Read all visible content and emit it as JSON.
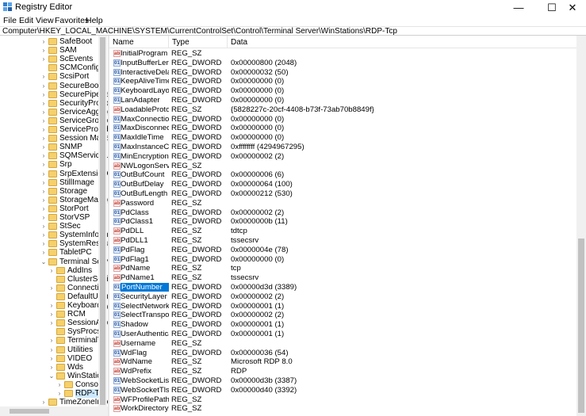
{
  "window": {
    "title": "Registry Editor",
    "controls": {
      "minimize": "—",
      "maximize": "☐",
      "close": "✕"
    }
  },
  "menu": [
    "File",
    "Edit",
    "View",
    "Favorites",
    "Help"
  ],
  "address": "Computer\\HKEY_LOCAL_MACHINE\\SYSTEM\\CurrentControlSet\\Control\\Terminal Server\\WinStations\\RDP-Tcp",
  "tree": {
    "items": [
      {
        "label": "SafeBoot",
        "depth": 0,
        "chevron": "›"
      },
      {
        "label": "SAM",
        "depth": 0,
        "chevron": "›"
      },
      {
        "label": "ScEvents",
        "depth": 0,
        "chevron": "›"
      },
      {
        "label": "SCMConfig",
        "depth": 0,
        "chevron": ""
      },
      {
        "label": "ScsiPort",
        "depth": 0,
        "chevron": "›"
      },
      {
        "label": "SecureBoot",
        "depth": 0,
        "chevron": "›"
      },
      {
        "label": "SecurePipeSer",
        "depth": 0,
        "chevron": "›"
      },
      {
        "label": "SecurityProvid",
        "depth": 0,
        "chevron": "›"
      },
      {
        "label": "ServiceAggreg",
        "depth": 0,
        "chevron": "›"
      },
      {
        "label": "ServiceGroupC",
        "depth": 0,
        "chevron": "›"
      },
      {
        "label": "ServiceProvide",
        "depth": 0,
        "chevron": "›"
      },
      {
        "label": "Session Manag",
        "depth": 0,
        "chevron": "›"
      },
      {
        "label": "SNMP",
        "depth": 0,
        "chevron": "›"
      },
      {
        "label": "SQMServiceLis",
        "depth": 0,
        "chevron": "›"
      },
      {
        "label": "Srp",
        "depth": 0,
        "chevron": "›"
      },
      {
        "label": "SrpExtensionC",
        "depth": 0,
        "chevron": "›"
      },
      {
        "label": "StillImage",
        "depth": 0,
        "chevron": "›"
      },
      {
        "label": "Storage",
        "depth": 0,
        "chevron": "›"
      },
      {
        "label": "StorageManag",
        "depth": 0,
        "chevron": "›"
      },
      {
        "label": "StorPort",
        "depth": 0,
        "chevron": "›"
      },
      {
        "label": "StorVSP",
        "depth": 0,
        "chevron": "›"
      },
      {
        "label": "StSec",
        "depth": 0,
        "chevron": "›"
      },
      {
        "label": "SystemInform",
        "depth": 0,
        "chevron": "›"
      },
      {
        "label": "SystemResour",
        "depth": 0,
        "chevron": "›"
      },
      {
        "label": "TabletPC",
        "depth": 0,
        "chevron": "›"
      },
      {
        "label": "Terminal Serve",
        "depth": 0,
        "chevron": "⌄"
      },
      {
        "label": "AddIns",
        "depth": 1,
        "chevron": "›"
      },
      {
        "label": "ClusterSetti",
        "depth": 1,
        "chevron": ""
      },
      {
        "label": "Connection",
        "depth": 1,
        "chevron": "›"
      },
      {
        "label": "DefaultUser",
        "depth": 1,
        "chevron": ""
      },
      {
        "label": "KeyboardTy",
        "depth": 1,
        "chevron": "›"
      },
      {
        "label": "RCM",
        "depth": 1,
        "chevron": "›"
      },
      {
        "label": "SessionArb",
        "depth": 1,
        "chevron": "›"
      },
      {
        "label": "SysProcs",
        "depth": 1,
        "chevron": ""
      },
      {
        "label": "TerminalTy",
        "depth": 1,
        "chevron": "›"
      },
      {
        "label": "Utilities",
        "depth": 1,
        "chevron": "›"
      },
      {
        "label": "VIDEO",
        "depth": 1,
        "chevron": "›"
      },
      {
        "label": "Wds",
        "depth": 1,
        "chevron": "›"
      },
      {
        "label": "WinStation",
        "depth": 1,
        "chevron": "⌄"
      },
      {
        "label": "Console",
        "depth": 2,
        "chevron": "›"
      },
      {
        "label": "RDP-Tcp",
        "depth": 2,
        "chevron": "›",
        "selected": true
      },
      {
        "label": "TimeZoneInfo",
        "depth": 0,
        "chevron": "›"
      }
    ]
  },
  "list": {
    "headers": {
      "name": "Name",
      "type": "Type",
      "data": "Data"
    },
    "rows": [
      {
        "name": "InitialProgram",
        "type": "REG_SZ",
        "data": "",
        "kind": "sz"
      },
      {
        "name": "InputBufferLeng...",
        "type": "REG_DWORD",
        "data": "0x00000800 (2048)",
        "kind": "bin"
      },
      {
        "name": "InteractiveDelay",
        "type": "REG_DWORD",
        "data": "0x00000032 (50)",
        "kind": "bin"
      },
      {
        "name": "KeepAliveTimeout",
        "type": "REG_DWORD",
        "data": "0x00000000 (0)",
        "kind": "bin"
      },
      {
        "name": "KeyboardLayout",
        "type": "REG_DWORD",
        "data": "0x00000000 (0)",
        "kind": "bin"
      },
      {
        "name": "LanAdapter",
        "type": "REG_DWORD",
        "data": "0x00000000 (0)",
        "kind": "bin"
      },
      {
        "name": "LoadableProtoc...",
        "type": "REG_SZ",
        "data": "{5828227c-20cf-4408-b73f-73ab70b8849f}",
        "kind": "sz"
      },
      {
        "name": "MaxConnection...",
        "type": "REG_DWORD",
        "data": "0x00000000 (0)",
        "kind": "bin"
      },
      {
        "name": "MaxDisconnecti...",
        "type": "REG_DWORD",
        "data": "0x00000000 (0)",
        "kind": "bin"
      },
      {
        "name": "MaxIdleTime",
        "type": "REG_DWORD",
        "data": "0x00000000 (0)",
        "kind": "bin"
      },
      {
        "name": "MaxInstanceCo...",
        "type": "REG_DWORD",
        "data": "0xffffffff (4294967295)",
        "kind": "bin"
      },
      {
        "name": "MinEncryptionL...",
        "type": "REG_DWORD",
        "data": "0x00000002 (2)",
        "kind": "bin"
      },
      {
        "name": "NWLogonServer",
        "type": "REG_SZ",
        "data": "",
        "kind": "sz"
      },
      {
        "name": "OutBufCount",
        "type": "REG_DWORD",
        "data": "0x00000006 (6)",
        "kind": "bin"
      },
      {
        "name": "OutBufDelay",
        "type": "REG_DWORD",
        "data": "0x00000064 (100)",
        "kind": "bin"
      },
      {
        "name": "OutBufLength",
        "type": "REG_DWORD",
        "data": "0x00000212 (530)",
        "kind": "bin"
      },
      {
        "name": "Password",
        "type": "REG_SZ",
        "data": "",
        "kind": "sz"
      },
      {
        "name": "PdClass",
        "type": "REG_DWORD",
        "data": "0x00000002 (2)",
        "kind": "bin"
      },
      {
        "name": "PdClass1",
        "type": "REG_DWORD",
        "data": "0x0000000b (11)",
        "kind": "bin"
      },
      {
        "name": "PdDLL",
        "type": "REG_SZ",
        "data": "tdtcp",
        "kind": "sz"
      },
      {
        "name": "PdDLL1",
        "type": "REG_SZ",
        "data": "tssecsrv",
        "kind": "sz"
      },
      {
        "name": "PdFlag",
        "type": "REG_DWORD",
        "data": "0x0000004e (78)",
        "kind": "bin"
      },
      {
        "name": "PdFlag1",
        "type": "REG_DWORD",
        "data": "0x00000000 (0)",
        "kind": "bin"
      },
      {
        "name": "PdName",
        "type": "REG_SZ",
        "data": "tcp",
        "kind": "sz"
      },
      {
        "name": "PdName1",
        "type": "REG_SZ",
        "data": "tssecsrv",
        "kind": "sz"
      },
      {
        "name": "PortNumber",
        "type": "REG_DWORD",
        "data": "0x00000d3d (3389)",
        "kind": "bin",
        "selected": true
      },
      {
        "name": "SecurityLayer",
        "type": "REG_DWORD",
        "data": "0x00000002 (2)",
        "kind": "bin"
      },
      {
        "name": "SelectNetworkD...",
        "type": "REG_DWORD",
        "data": "0x00000001 (1)",
        "kind": "bin"
      },
      {
        "name": "SelectTransport",
        "type": "REG_DWORD",
        "data": "0x00000002 (2)",
        "kind": "bin"
      },
      {
        "name": "Shadow",
        "type": "REG_DWORD",
        "data": "0x00000001 (1)",
        "kind": "bin"
      },
      {
        "name": "UserAuthenticat...",
        "type": "REG_DWORD",
        "data": "0x00000001 (1)",
        "kind": "bin"
      },
      {
        "name": "Username",
        "type": "REG_SZ",
        "data": "",
        "kind": "sz"
      },
      {
        "name": "WdFlag",
        "type": "REG_DWORD",
        "data": "0x00000036 (54)",
        "kind": "bin"
      },
      {
        "name": "WdName",
        "type": "REG_SZ",
        "data": "Microsoft RDP 8.0",
        "kind": "sz"
      },
      {
        "name": "WdPrefix",
        "type": "REG_SZ",
        "data": "RDP",
        "kind": "sz"
      },
      {
        "name": "WebSocketListe...",
        "type": "REG_DWORD",
        "data": "0x00000d3b (3387)",
        "kind": "bin"
      },
      {
        "name": "WebSocketTlsLis...",
        "type": "REG_DWORD",
        "data": "0x00000d40 (3392)",
        "kind": "bin"
      },
      {
        "name": "WFProfilePath",
        "type": "REG_SZ",
        "data": "",
        "kind": "sz"
      },
      {
        "name": "WorkDirectory",
        "type": "REG_SZ",
        "data": "",
        "kind": "sz"
      }
    ]
  }
}
